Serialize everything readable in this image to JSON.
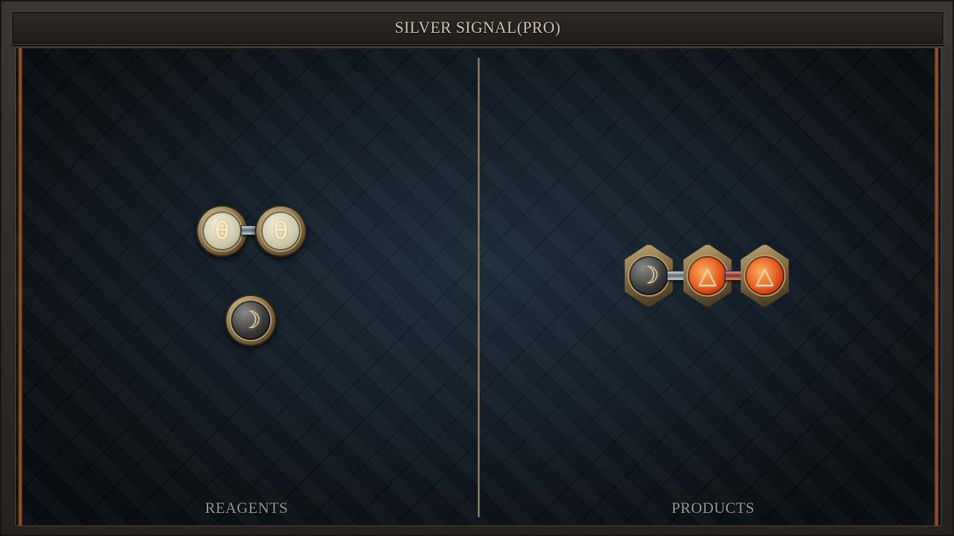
{
  "title": "SILVER SIGNAL(PRO)",
  "panels": {
    "reagents_label": "REAGENTS",
    "products_label": "PRODUCTS"
  },
  "molecules": {
    "reagent_salt_pair": [
      {
        "element": "salt",
        "glyph": "θ"
      },
      {
        "element": "salt",
        "glyph": "θ"
      }
    ],
    "reagent_silver": {
      "element": "silver",
      "glyph": "☽"
    },
    "product_chain": [
      {
        "element": "silver",
        "glyph": "☽"
      },
      {
        "element": "fire",
        "glyph": "△"
      },
      {
        "element": "fire",
        "glyph": "△"
      }
    ]
  },
  "colors": {
    "frame": "#2b2926",
    "board": "#17222c",
    "accent_copper": "#a8582a",
    "title_text": "#cfc4b0",
    "label_text": "#9a958d"
  }
}
